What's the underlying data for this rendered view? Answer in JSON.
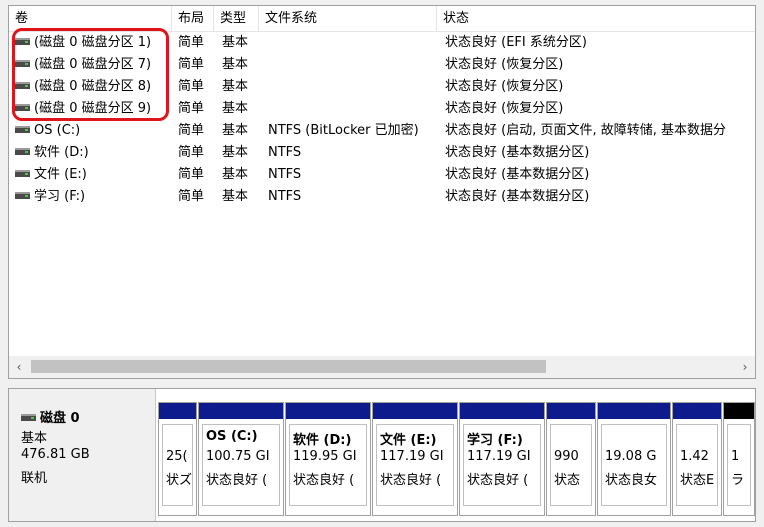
{
  "columns": [
    "卷",
    "布局",
    "类型",
    "文件系统",
    "状态"
  ],
  "volumes": [
    {
      "name": "(磁盘 0 磁盘分区 1)",
      "layout": "简单",
      "type": "基本",
      "fs": "",
      "status": "状态良好 (EFI 系统分区)"
    },
    {
      "name": "(磁盘 0 磁盘分区 7)",
      "layout": "简单",
      "type": "基本",
      "fs": "",
      "status": "状态良好 (恢复分区)"
    },
    {
      "name": "(磁盘 0 磁盘分区 8)",
      "layout": "简单",
      "type": "基本",
      "fs": "",
      "status": "状态良好 (恢复分区)"
    },
    {
      "name": "(磁盘 0 磁盘分区 9)",
      "layout": "简单",
      "type": "基本",
      "fs": "",
      "status": "状态良好 (恢复分区)"
    },
    {
      "name": "OS (C:)",
      "layout": "简单",
      "type": "基本",
      "fs": "NTFS (BitLocker 已加密)",
      "status": "状态良好 (启动, 页面文件, 故障转储, 基本数据分"
    },
    {
      "name": "软件 (D:)",
      "layout": "简单",
      "type": "基本",
      "fs": "NTFS",
      "status": "状态良好 (基本数据分区)"
    },
    {
      "name": "文件 (E:)",
      "layout": "简单",
      "type": "基本",
      "fs": "NTFS",
      "status": "状态良好 (基本数据分区)"
    },
    {
      "name": "学习 (F:)",
      "layout": "简单",
      "type": "基本",
      "fs": "NTFS",
      "status": "状态良好 (基本数据分区)"
    }
  ],
  "scroll": {
    "left_arrow": "‹",
    "right_arrow": "›"
  },
  "disk": {
    "title": "磁盘 0",
    "kind": "基本",
    "size": "476.81 GB",
    "state": "联机",
    "partitions": [
      {
        "name": "",
        "size": "25(",
        "status": "状ズ"
      },
      {
        "name": "OS  (C:)",
        "size": "100.75 GI",
        "status": "状态良好 ("
      },
      {
        "name": "软件  (D:)",
        "size": "119.95 GI",
        "status": "状态良好 ("
      },
      {
        "name": "文件  (E:)",
        "size": "117.19 GI",
        "status": "状态良好 ("
      },
      {
        "name": "学习  (F:)",
        "size": "117.19 GI",
        "status": "状态良好 ("
      },
      {
        "name": "",
        "size": "990",
        "status": "状态"
      },
      {
        "name": "",
        "size": "19.08 G",
        "status": "状态良女"
      },
      {
        "name": "",
        "size": "1.42",
        "status": "状态E"
      },
      {
        "name": "",
        "size": "1",
        "status": "ラ"
      }
    ]
  },
  "colors": {
    "partition_bar": "#0e1b8c",
    "highlight": "#e0141b",
    "status_ok_light": "#3ad13a"
  },
  "icons": {
    "volume": "drive-icon"
  }
}
